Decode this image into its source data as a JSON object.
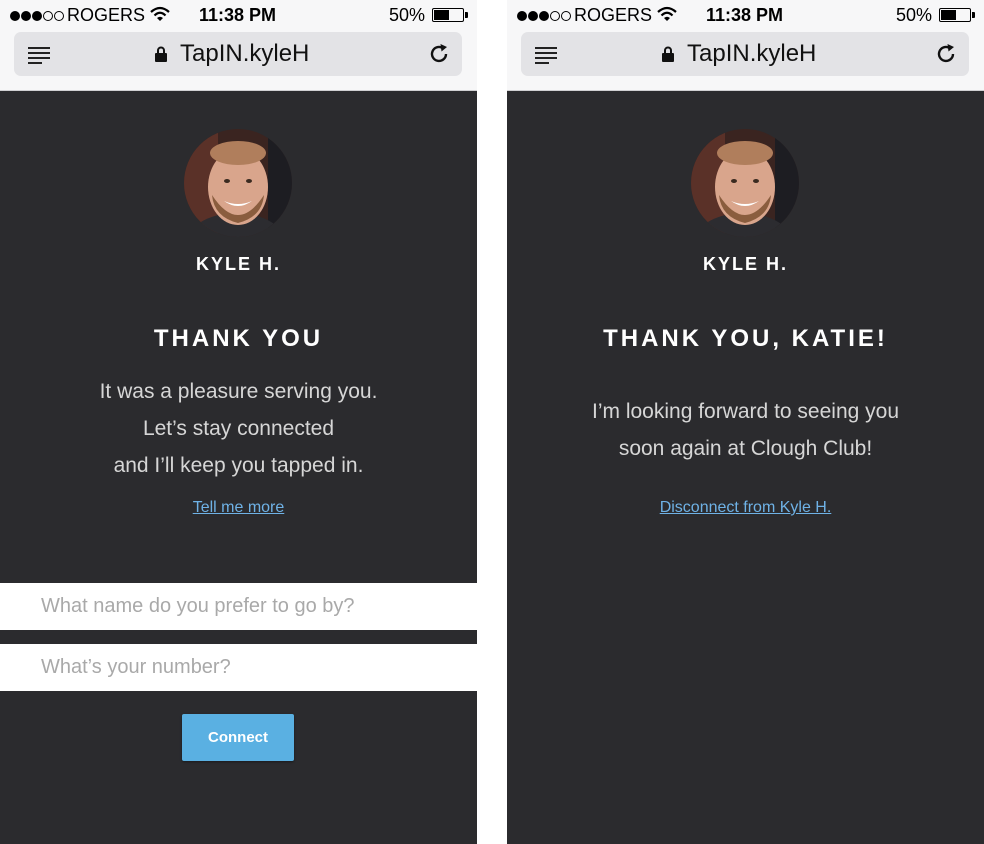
{
  "status_bar": {
    "carrier": "ROGERS",
    "time": "11:38 PM",
    "battery": "50%"
  },
  "browser": {
    "url": "TapIN.kyleH"
  },
  "left_screen": {
    "server_name": "KYLE H.",
    "heading": "THANK YOU",
    "message_lines": [
      "It was a pleasure serving you.",
      "Let’s stay connected",
      "and I’ll keep you tapped in."
    ],
    "tell_more_link": "Tell me more",
    "name_placeholder": "What name do you prefer to go by?",
    "number_placeholder": "What’s your number?",
    "connect_label": "Connect"
  },
  "right_screen": {
    "server_name": "KYLE H.",
    "heading": "THANK YOU, KATIE!",
    "message_lines": [
      "I’m looking forward to seeing you",
      "soon again at Clough Club!"
    ],
    "disconnect_link": "Disconnect from Kyle H."
  },
  "colors": {
    "background": "#2b2b2e",
    "accent": "#5ab0e2",
    "link": "#6fb2e6"
  }
}
